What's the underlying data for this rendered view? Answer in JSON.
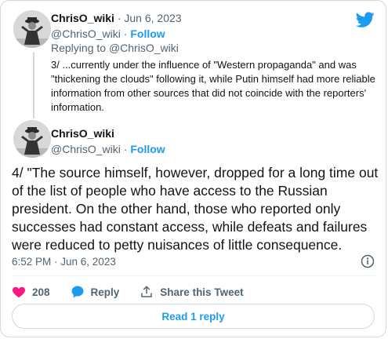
{
  "colors": {
    "accent": "#1d9bf0",
    "like": "#f91880",
    "muted": "#536471",
    "text": "#0f1419",
    "border": "#cfd9de"
  },
  "parent_tweet": {
    "display_name": "ChrisO_wiki",
    "dot": "·",
    "date": "Jun 6, 2023",
    "handle": "@ChrisO_wiki",
    "follow_label": "Follow",
    "replying_prefix": "Replying to",
    "replying_handle": "@ChrisO_wiki",
    "text": "3/ ...currently under the influence of \"Western propaganda\" and was \"thickening the clouds\" following it, while Putin himself had more reliable information from other sources that did not coincide with the reporters' information."
  },
  "main_tweet": {
    "display_name": "ChrisO_wiki",
    "handle": "@ChrisO_wiki",
    "follow_label": "Follow",
    "text": "4/ \"The source himself, however, dropped for a long time out of the list of people who have access to the Russian president. On the other hand, those who reported only successes had constant access, while defeats and failures were reduced to petty nuisances of little consequence.",
    "timestamp": "6:52 PM · Jun 6, 2023"
  },
  "actions": {
    "like_count": "208",
    "reply_label": "Reply",
    "share_label": "Share this Tweet"
  },
  "read_replies_label": "Read 1 reply",
  "icons": {
    "logo": "twitter-bird-icon",
    "info": "info-icon",
    "like": "heart-icon",
    "reply": "speech-bubble-icon",
    "share": "share-arrow-icon"
  }
}
